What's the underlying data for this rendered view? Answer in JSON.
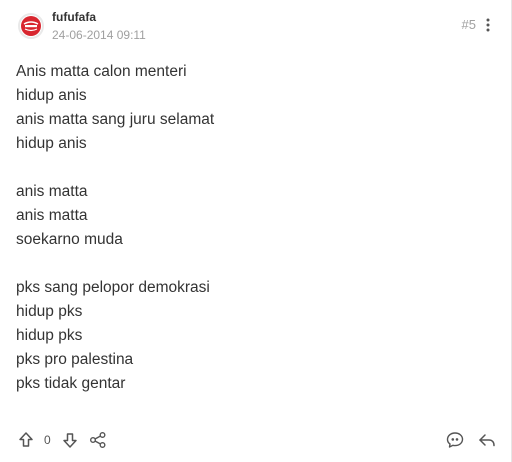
{
  "post": {
    "author": {
      "username": "fufufafa",
      "avatar_icon": "avatar-logo-icon",
      "avatar_color": "#d8262f"
    },
    "timestamp": "24-06-2014 09:11",
    "post_number": "#5",
    "menu_icon": "more-vertical-icon",
    "content_lines": [
      "Anis matta calon menteri",
      "hidup anis",
      "anis matta sang juru selamat",
      "hidup anis",
      "",
      "anis matta",
      "anis matta",
      "soekarno muda",
      "",
      "pks sang pelopor demokrasi",
      "hidup pks",
      "hidup pks",
      "pks pro palestina",
      "pks tidak gentar"
    ]
  },
  "actions": {
    "upvote_icon": "arrow-up-icon",
    "vote_count": "0",
    "downvote_icon": "arrow-down-icon",
    "share_icon": "share-icon",
    "quote_icon": "quote-bubble-icon",
    "reply_icon": "reply-icon",
    "icon_color": "#555555"
  }
}
